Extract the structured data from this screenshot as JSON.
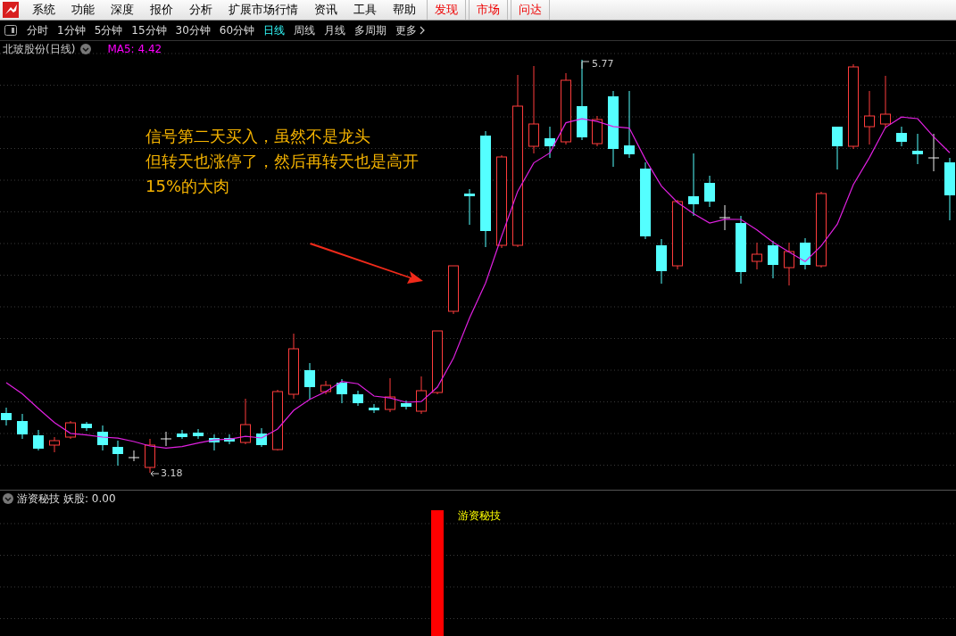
{
  "menu": [
    {
      "label": "系统",
      "kind": "normal"
    },
    {
      "label": "功能",
      "kind": "normal"
    },
    {
      "label": "深度",
      "kind": "normal"
    },
    {
      "label": "报价",
      "kind": "normal"
    },
    {
      "label": "分析",
      "kind": "normal"
    },
    {
      "label": "扩展市场行情",
      "kind": "normal"
    },
    {
      "label": "资讯",
      "kind": "normal"
    },
    {
      "label": "工具",
      "kind": "normal"
    },
    {
      "label": "帮助",
      "kind": "normal"
    },
    {
      "label": "发现",
      "kind": "feature"
    },
    {
      "label": "市场",
      "kind": "feature"
    },
    {
      "label": "问达",
      "kind": "feature"
    }
  ],
  "periods": [
    {
      "label": "分时",
      "selected": false
    },
    {
      "label": "1分钟",
      "selected": false
    },
    {
      "label": "5分钟",
      "selected": false
    },
    {
      "label": "15分钟",
      "selected": false
    },
    {
      "label": "30分钟",
      "selected": false
    },
    {
      "label": "60分钟",
      "selected": false
    },
    {
      "label": "日线",
      "selected": true
    },
    {
      "label": "周线",
      "selected": false
    },
    {
      "label": "月线",
      "selected": false
    },
    {
      "label": "多周期",
      "selected": false
    },
    {
      "label": "更多",
      "selected": false
    }
  ],
  "chart": {
    "title": "北玻股份(日线)",
    "ma_label": "MA5: 4.42",
    "high_label": "5.77",
    "low_label": "3.18",
    "annotation": [
      "信号第二天买入，虽然不是龙头",
      "但转天也涨停了，然后再转天也是高开",
      "15%的大肉"
    ]
  },
  "indicator": {
    "title": "游资秘技",
    "value_label": "妖股: 0.00",
    "signal_label": "游资秘技"
  }
}
